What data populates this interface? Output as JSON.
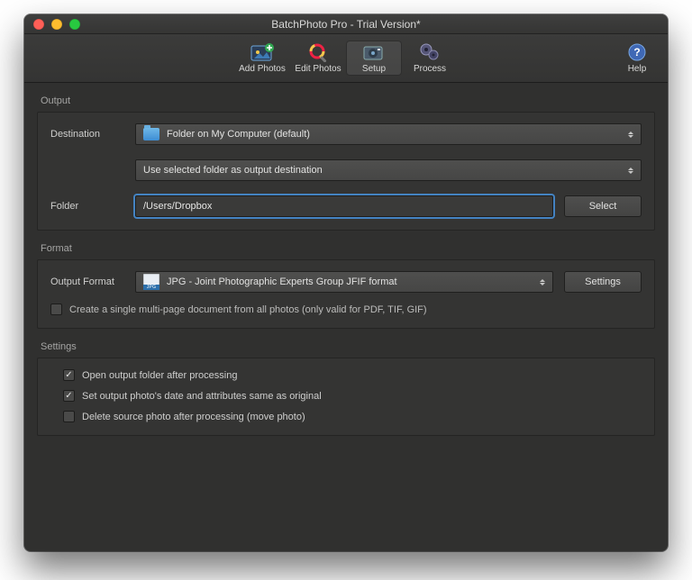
{
  "window": {
    "title": "BatchPhoto Pro - Trial Version*"
  },
  "toolbar": {
    "add_photos": "Add Photos",
    "edit_photos": "Edit Photos",
    "setup": "Setup",
    "process": "Process",
    "help": "Help"
  },
  "output": {
    "section": "Output",
    "destination_label": "Destination",
    "destination_value": "Folder on My Computer (default)",
    "strategy_value": "Use selected folder as output destination",
    "folder_label": "Folder",
    "folder_value": "/Users/Dropbox",
    "select_button": "Select"
  },
  "format": {
    "section": "Format",
    "output_format_label": "Output Format",
    "output_format_value": "JPG - Joint Photographic Experts Group JFIF format",
    "settings_button": "Settings",
    "multipage_label": "Create a single multi-page document from all photos (only valid for PDF, TIF, GIF)",
    "multipage_checked": false
  },
  "settings": {
    "section": "Settings",
    "open_after_label": "Open output folder after processing",
    "open_after_checked": true,
    "same_date_label": "Set output photo's date and attributes same as original",
    "same_date_checked": true,
    "delete_source_label": "Delete source photo after processing (move photo)",
    "delete_source_checked": false
  }
}
